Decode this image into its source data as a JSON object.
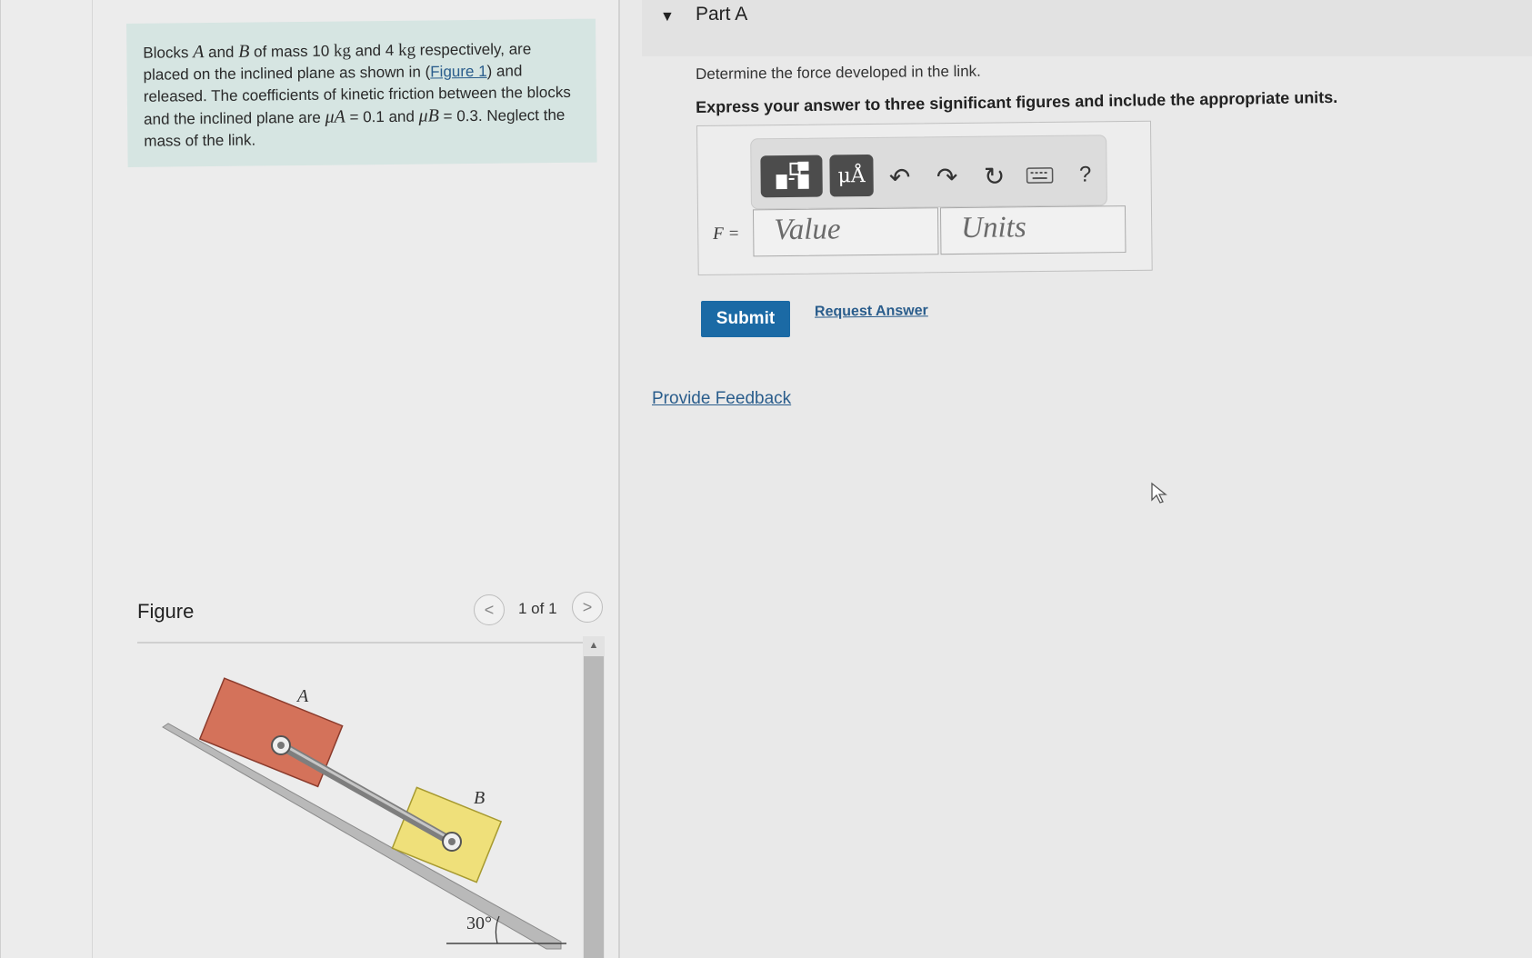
{
  "problem": {
    "text_1": "Blocks ",
    "var_a": "A",
    "text_2": " and ",
    "var_b": "B",
    "text_3": " of mass ",
    "mass_a": "10",
    "unit_kg_1": "kg",
    "text_4": " and ",
    "mass_b": "4",
    "unit_kg_2": "kg",
    "text_5": " respectively, are placed on the inclined plane as shown in (",
    "figure_link": "Figure 1",
    "text_6": ") and released. The coefficients of kinetic friction between the blocks and the inclined plane are ",
    "mu_a": "μA",
    "text_7": " = 0.1 and ",
    "mu_b": "μB",
    "text_8": " = 0.3. Neglect the mass of the link."
  },
  "figure": {
    "label": "Figure",
    "page_count": "1 of 1",
    "prev_symbol": "<",
    "next_symbol": ">",
    "scroll_up_symbol": "▲",
    "block_a_label": "A",
    "block_b_label": "B",
    "angle_label": "30°",
    "block_a_color": "#d4725a",
    "block_b_color": "#efe07a"
  },
  "part": {
    "caret": "▼",
    "title": "Part A",
    "question": "Determine the force developed in the link.",
    "instruction": "Express your answer to three significant figures and include the appropriate units."
  },
  "toolbar": {
    "units_symbol": "μÅ",
    "undo_symbol": "↶",
    "redo_symbol": "↷",
    "reset_symbol": "↻",
    "help_symbol": "?"
  },
  "answer": {
    "equation_label": "F =",
    "value_placeholder": "Value",
    "units_placeholder": "Units"
  },
  "actions": {
    "submit_label": "Submit",
    "request_answer_label": "Request Answer",
    "feedback_label": "Provide Feedback"
  },
  "colors": {
    "problem_bg": "#d6e5e2",
    "submit_bg": "#1b6aa5",
    "link_color": "#2a5d8c"
  }
}
